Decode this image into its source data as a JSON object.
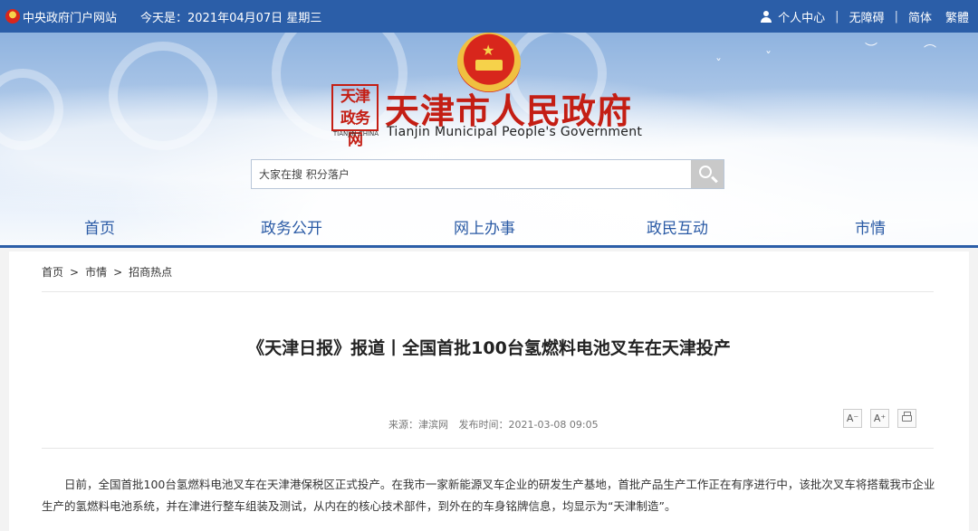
{
  "topbar": {
    "gov_portal": "中央政府门户网站",
    "date_text": "今天是：2021年04月07日 星期三",
    "personal_center": "个人中心",
    "accessibility": "无障碍",
    "simplified": "简体",
    "traditional": "繁體",
    "separator": "|"
  },
  "banner": {
    "seal_text": "天津 政务 网",
    "seal_caption": "TIANJIN·CHINA",
    "title": "天津市人民政府",
    "subtitle": "Tianjin Municipal People's Government"
  },
  "search": {
    "placeholder": "大家在搜 积分落户"
  },
  "nav": {
    "items": [
      "首页",
      "政务公开",
      "网上办事",
      "政民互动",
      "市情"
    ]
  },
  "breadcrumb": {
    "items": [
      "首页",
      "市情",
      "招商热点"
    ],
    "separator": ">"
  },
  "article": {
    "title": "《天津日报》报道丨全国首批100台氢燃料电池叉车在天津投产",
    "source": "来源：津滨网",
    "publish_time": "发布时间：2021-03-08 09:05",
    "font_decrease": "A⁻",
    "font_increase": "A⁺",
    "body": "日前，全国首批100台氢燃料电池叉车在天津港保税区正式投产。在我市一家新能源叉车企业的研发生产基地，首批产品生产工作正在有序进行中，该批次叉车将搭载我市企业生产的氢燃料电池系统，并在津进行整车组装及测试，从内在的核心技术部件，到外在的车身铭牌信息，均显示为“天津制造”。"
  },
  "colors": {
    "topbar_bg": "#2b5ea8",
    "nav_text": "#2a5aa5",
    "title_red": "#c41e14"
  }
}
